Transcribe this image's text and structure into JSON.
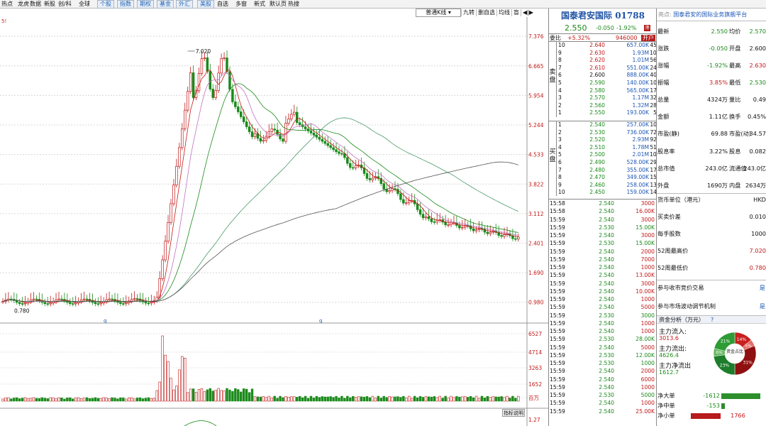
{
  "topnav": [
    "热点",
    "龙虎",
    "数据",
    "新股",
    "创/科",
    "全球",
    "个股",
    "指数",
    "期权",
    "基金",
    "外汇",
    "美股",
    "自选",
    "多窗",
    "新式",
    "默认页",
    "热搜"
  ],
  "toolbar": {
    "period": "普通K线",
    "b1": "九转",
    "b2": "删自选",
    "b3": "均线",
    "b4": "盲",
    "b5": "◀|▶"
  },
  "stock": {
    "title": "国泰君安国际 01788",
    "price": "2.550",
    "change": "-0.050",
    "pct": "-1.92%",
    "icon": "港"
  },
  "weibi": {
    "label": "委比",
    "ratio": "+5.32%",
    "diff": "946000",
    "badge": "开户"
  },
  "side_sell": "卖盘",
  "side_buy": "买盘",
  "asks": [
    {
      "n": "10",
      "p": "2.640",
      "v": "657.00K",
      "c": "45"
    },
    {
      "n": "9",
      "p": "2.630",
      "v": "1.93M",
      "c": "108"
    },
    {
      "n": "8",
      "p": "2.620",
      "v": "1.01M",
      "c": "56"
    },
    {
      "n": "7",
      "p": "2.610",
      "v": "551.00K",
      "c": "24"
    },
    {
      "n": "6",
      "p": "2.600",
      "v": "888.00K",
      "c": "40"
    },
    {
      "n": "5",
      "p": "2.590",
      "v": "140.00K",
      "c": "10"
    },
    {
      "n": "4",
      "p": "2.580",
      "v": "565.00K",
      "c": "17"
    },
    {
      "n": "3",
      "p": "2.570",
      "v": "1.17M",
      "c": "32"
    },
    {
      "n": "2",
      "p": "2.560",
      "v": "1.32M",
      "c": "28"
    },
    {
      "n": "1",
      "p": "2.550",
      "v": "193.00K",
      "c": "5"
    }
  ],
  "bids": [
    {
      "n": "1",
      "p": "2.540",
      "v": "257.00K",
      "c": "10"
    },
    {
      "n": "2",
      "p": "2.530",
      "v": "736.00K",
      "c": "72"
    },
    {
      "n": "3",
      "p": "2.520",
      "v": "2.93M",
      "c": "92"
    },
    {
      "n": "4",
      "p": "2.510",
      "v": "1.78M",
      "c": "51"
    },
    {
      "n": "5",
      "p": "2.500",
      "v": "2.01M",
      "c": "101"
    },
    {
      "n": "6",
      "p": "2.490",
      "v": "528.00K",
      "c": "29"
    },
    {
      "n": "7",
      "p": "2.480",
      "v": "355.00K",
      "c": "17"
    },
    {
      "n": "8",
      "p": "2.470",
      "v": "349.00K",
      "c": "15"
    },
    {
      "n": "9",
      "p": "2.460",
      "v": "258.00K",
      "c": "13"
    },
    {
      "n": "10",
      "p": "2.450",
      "v": "159.00K",
      "c": "14"
    }
  ],
  "ticks": [
    {
      "t": "15:58",
      "p": "2.540",
      "v": "3000"
    },
    {
      "t": "15:58",
      "p": "2.540",
      "v": "16.00K"
    },
    {
      "t": "15:59",
      "p": "2.540",
      "v": "3000"
    },
    {
      "t": "15:59",
      "p": "2.530",
      "v": "15.00K"
    },
    {
      "t": "15:59",
      "p": "2.540",
      "v": "3000"
    },
    {
      "t": "15:59",
      "p": "2.530",
      "v": "15.00K"
    },
    {
      "t": "15:59",
      "p": "2.540",
      "v": "2000"
    },
    {
      "t": "15:59",
      "p": "2.540",
      "v": "7000"
    },
    {
      "t": "15:59",
      "p": "2.540",
      "v": "1000"
    },
    {
      "t": "15:59",
      "p": "2.540",
      "v": "13.00K"
    },
    {
      "t": "15:59",
      "p": "2.540",
      "v": "3000"
    },
    {
      "t": "15:59",
      "p": "2.540",
      "v": "10.00K"
    },
    {
      "t": "15:59",
      "p": "2.540",
      "v": "1000"
    },
    {
      "t": "15:59",
      "p": "2.540",
      "v": "5000"
    },
    {
      "t": "15:59",
      "p": "2.530",
      "v": "3000"
    },
    {
      "t": "15:59",
      "p": "2.540",
      "v": "1000"
    },
    {
      "t": "15:59",
      "p": "2.540",
      "v": "1000"
    },
    {
      "t": "15:59",
      "p": "2.530",
      "v": "28.00K"
    },
    {
      "t": "15:59",
      "p": "2.540",
      "v": "5000"
    },
    {
      "t": "15:59",
      "p": "2.530",
      "v": "12.00K"
    },
    {
      "t": "15:59",
      "p": "2.530",
      "v": "1000"
    },
    {
      "t": "15:59",
      "p": "2.540",
      "v": "2000"
    },
    {
      "t": "15:59",
      "p": "2.540",
      "v": "6000"
    },
    {
      "t": "15:59",
      "p": "2.540",
      "v": "1000"
    },
    {
      "t": "15:59",
      "p": "2.530",
      "v": "5000"
    },
    {
      "t": "15:59",
      "p": "2.540",
      "v": "1000"
    },
    {
      "t": "15:59",
      "p": "2.540",
      "v": "25.00K"
    }
  ],
  "fp": {
    "prefix": "亮点:",
    "headline": "国泰君安的国际业务旗舰平台",
    "rows": [
      [
        "最新",
        "2.550",
        "均价",
        "2.570"
      ],
      [
        "涨跌",
        "-0.050",
        "开盘",
        "2.600"
      ],
      [
        "涨幅",
        "-1.92%",
        "最高",
        "2.630"
      ],
      [
        "振幅",
        "3.85%",
        "最低",
        "2.530"
      ],
      [
        "总量",
        "4324万",
        "量比",
        "0.49"
      ],
      [
        "金额",
        "1.11亿",
        "换手",
        "0.45%"
      ],
      [
        "市盈(静)",
        "69.88",
        "市盈(动)",
        "34.57"
      ],
      [
        "股息率",
        "3.22%",
        "股息",
        "0.082"
      ],
      [
        "总市值",
        "243.0亿",
        "流通值",
        "243.0亿"
      ],
      [
        "外盘",
        "1690万",
        "内盘",
        "2634万"
      ]
    ],
    "info": [
      [
        "货币单位（港元）",
        "HKD"
      ],
      [
        "买卖价差",
        "0.010"
      ],
      [
        "每手股数",
        "1000"
      ],
      [
        "52周最高价",
        "7.020"
      ],
      [
        "52周最低价",
        "0.780"
      ]
    ],
    "flags": [
      [
        "参与收市竞价交易",
        "是"
      ],
      [
        "参与市场波动调节机制",
        "是"
      ]
    ],
    "fund": {
      "title": "资金分析（万元）",
      "help": "?",
      "in_label": "主力流入:",
      "in_val": "3013.6",
      "out_label": "主力流出:",
      "out_val": "4626.4",
      "net_label": "主力净流出",
      "net_val": "1612.7",
      "pie_center": "资金占比",
      "pie": [
        {
          "label": "14%",
          "v": 14,
          "color": "#c8201f"
        },
        {
          "label": "5%",
          "v": 5,
          "color": "#e86a63"
        },
        {
          "label": "31%",
          "v": 31,
          "color": "#8f1010"
        },
        {
          "label": "23%",
          "v": 23,
          "color": "#1c7d2a"
        },
        {
          "label": "6%",
          "v": 6,
          "color": "#64b85f"
        },
        {
          "label": "21%",
          "v": 21,
          "color": "#2e9b35"
        }
      ]
    },
    "orders": [
      {
        "label": "净大单",
        "val": "-1612",
        "num": -1612
      },
      {
        "label": "净中单",
        "val": "-153",
        "num": -153
      },
      {
        "label": "净小单",
        "val": "1766",
        "num": 1766
      }
    ]
  },
  "axis_price": [
    "7.376",
    "6.665",
    "5.954",
    "5.244",
    "4.533",
    "3.822",
    "3.112",
    "2.401",
    "1.690",
    "0.980"
  ],
  "axis_vol": [
    "6527",
    "4714",
    "3263",
    "1652",
    "百万"
  ],
  "axis_ind": "1.27",
  "chart_notes": {
    "high": "7.020",
    "low": "0.780",
    "marker": "q",
    "marker_top": "5!"
  },
  "indicator_btn": "指标说明",
  "colors": {
    "up": "#c21818",
    "down": "#1b8a1b",
    "ma1": "#555555",
    "ma2": "#c21818",
    "ma3": "#c070c0",
    "ma4": "#1b8a1b",
    "ma5": "#4a9a6a"
  }
}
